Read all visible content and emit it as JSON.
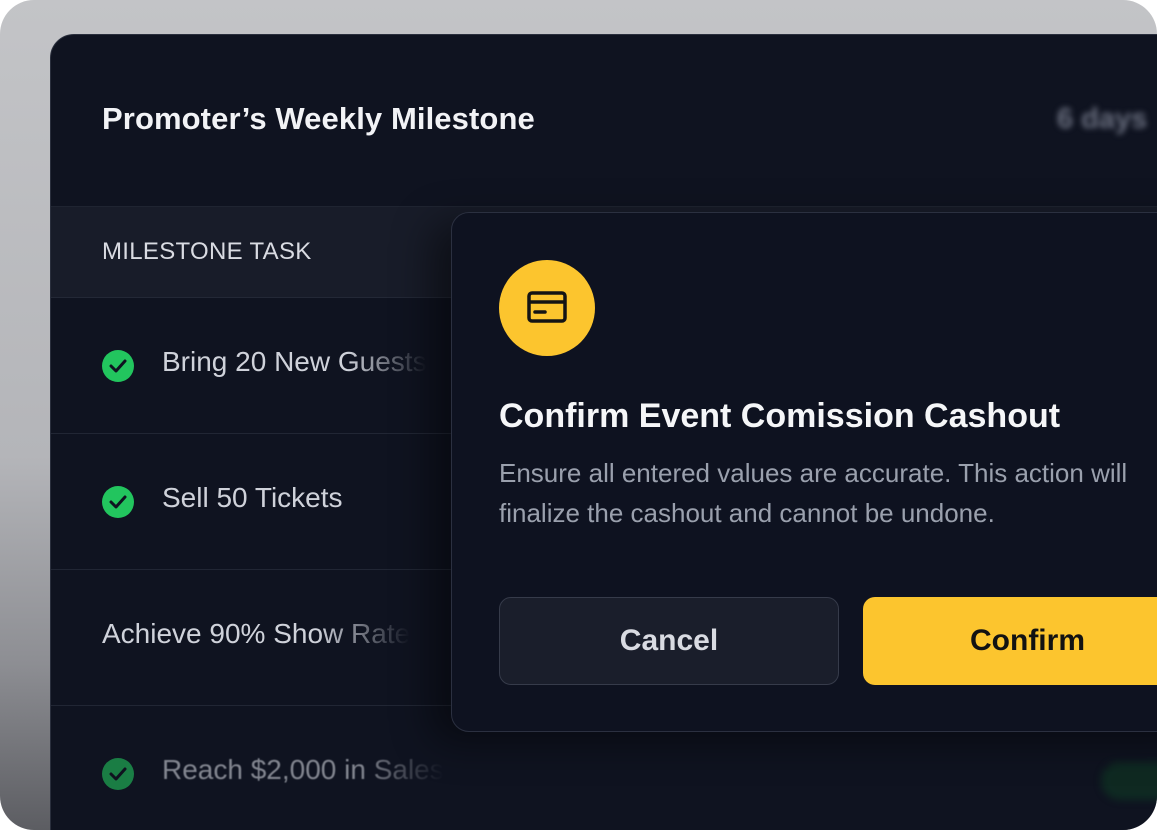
{
  "panel": {
    "title": "Promoter’s Weekly Milestone",
    "days_left": "6 days"
  },
  "table": {
    "header": "MILESTONE TASK",
    "rows": [
      {
        "label": "Bring 20 New Guests",
        "completed": true
      },
      {
        "label": "Sell 50 Tickets",
        "completed": true
      },
      {
        "label": "Achieve 90% Show Rate",
        "completed": false
      },
      {
        "label": "Reach $2,000 in Sales",
        "completed": true
      }
    ]
  },
  "modal": {
    "icon": "credit-card-icon",
    "title": "Confirm Event Comission Cashout",
    "description": "Ensure all entered values are accurate. This action will finalize the cashout and cannot be undone.",
    "cancel_label": "Cancel",
    "confirm_label": "Confirm"
  },
  "colors": {
    "accent": "#fcc52e",
    "success": "#22c55e",
    "background": "#0f1320"
  }
}
